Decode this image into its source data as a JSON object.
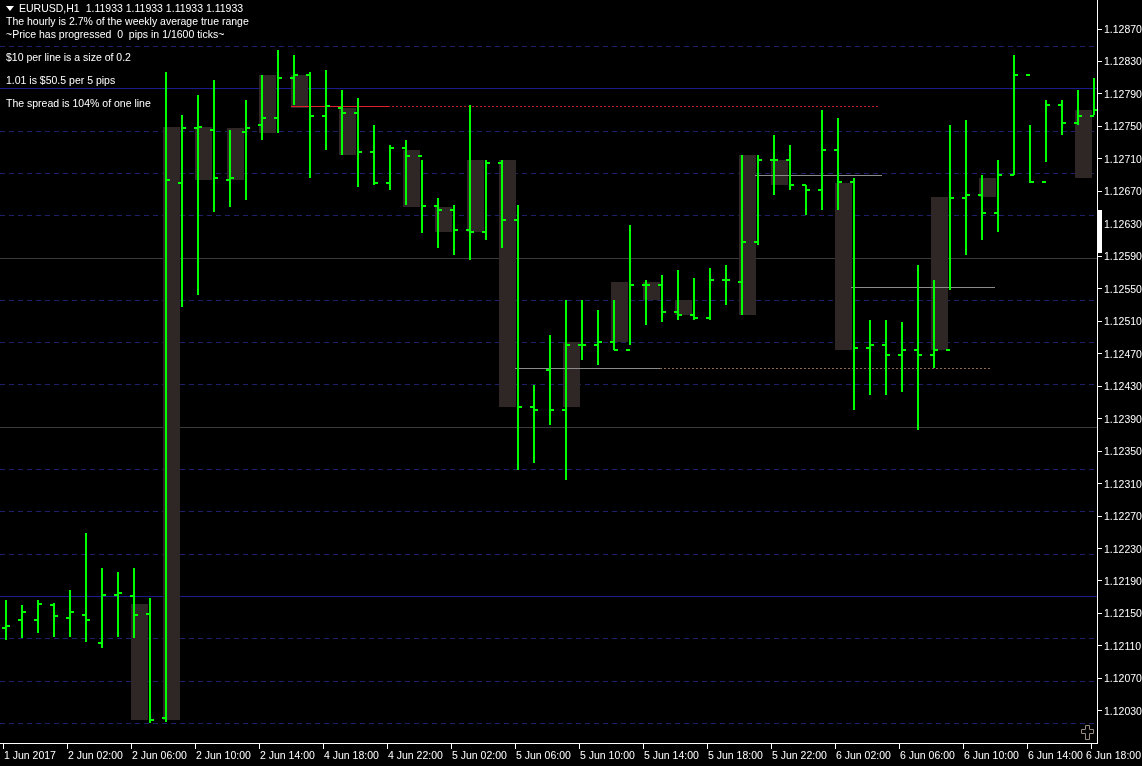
{
  "chart_header": {
    "symbol": "EURUSD,H1",
    "prices": "1.11933 1.11933 1.11933 1.11933"
  },
  "status_lines": [
    "The hourly is 2.7% of the weekly average true range",
    "~Price has progressed  0  pips in 1/1600 ticks~"
  ],
  "notes": [
    "$10 per line is a size of 0.2",
    "1.01 is $50.5 per 5 pips",
    "The spread is 104% of one line"
  ],
  "price_axis": [
    "1.12870",
    "1.12830",
    "1.12790",
    "1.12750",
    "1.12710",
    "1.12670",
    "1.12630",
    "1.12590",
    "1.12550",
    "1.12510",
    "1.12470",
    "1.12430",
    "1.12390",
    "1.12350",
    "1.12310",
    "1.12270",
    "1.12230",
    "1.12190",
    "1.12150",
    "1.12110",
    "1.12070",
    "1.12030"
  ],
  "time_axis": [
    "1 Jun 2017",
    "2 Jun 02:00",
    "2 Jun 06:00",
    "2 Jun 10:00",
    "2 Jun 14:00",
    "4 Jun 18:00",
    "4 Jun 22:00",
    "5 Jun 02:00",
    "5 Jun 06:00",
    "5 Jun 10:00",
    "5 Jun 14:00",
    "5 Jun 18:00",
    "5 Jun 22:00",
    "6 Jun 02:00",
    "6 Jun 06:00",
    "6 Jun 10:00",
    "6 Jun 14:00",
    "6 Jun 18:00"
  ]
}
